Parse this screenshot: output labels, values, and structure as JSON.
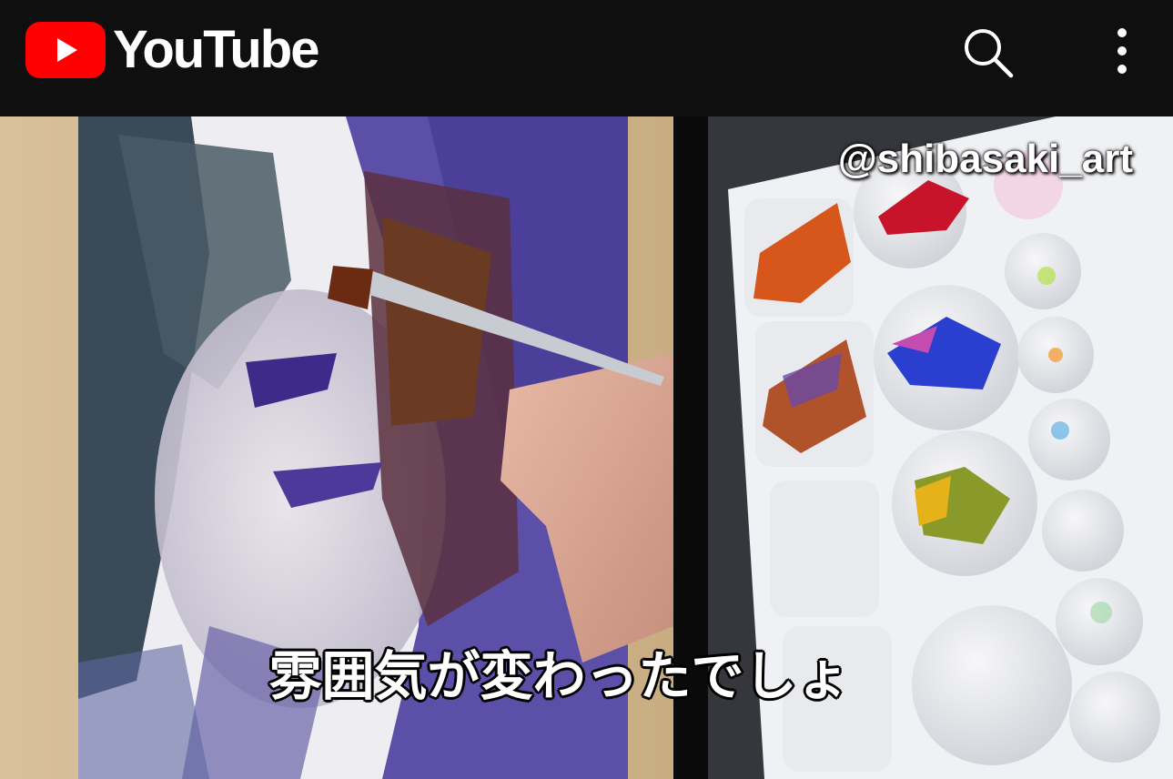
{
  "app": {
    "name": "YouTube",
    "brand_color": "#ff0000"
  },
  "header": {
    "logo_text": "YouTube",
    "search_icon": "search-icon",
    "more_icon": "more-vert-icon"
  },
  "video": {
    "watermark": "@shibasaki_art",
    "caption": "雰囲気が変わったでしょ"
  }
}
